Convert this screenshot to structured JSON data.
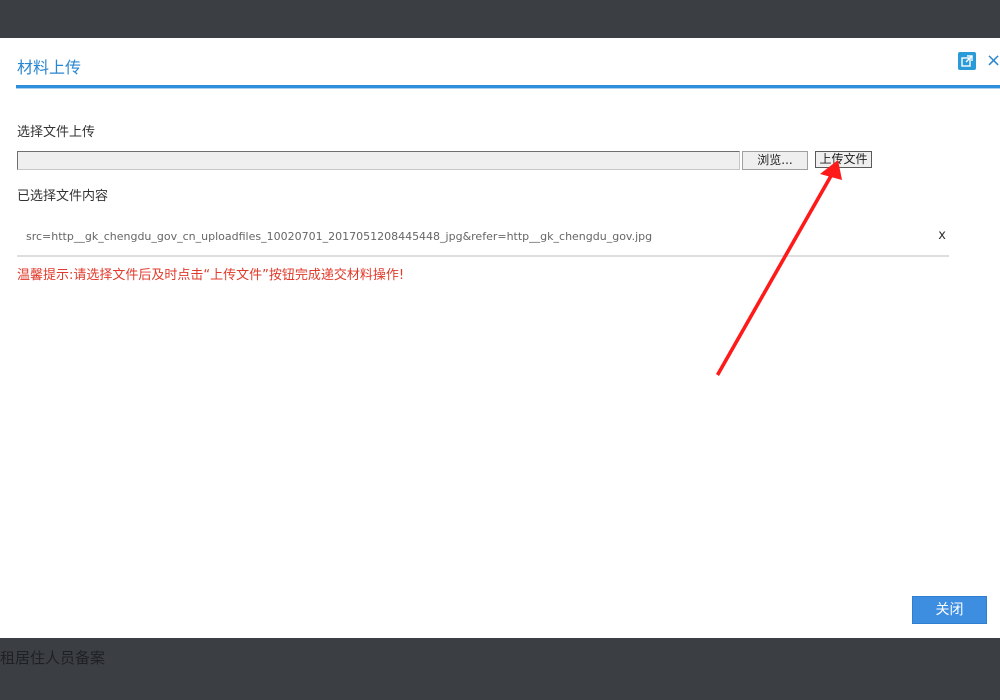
{
  "background": {
    "top_text": "",
    "bottom_text": "租居住人员备案"
  },
  "modal": {
    "title": "材料上传",
    "section_select_label": "选择文件上传",
    "browse_label": "浏览...",
    "upload_label": "上传文件",
    "section_selected_label": "已选择文件内容",
    "selected_files": [
      {
        "name": "src=http__gk_chengdu_gov_cn_uploadfiles_10020701_2017051208445448_jpg&refer=http__gk_chengdu_gov.jpg",
        "remove_label": "x"
      }
    ],
    "tip": "温馨提示:请选择文件后及时点击“上传文件”按钮完成递交材料操作!",
    "close_label": "关闭",
    "close_symbol": "×"
  },
  "colors": {
    "accent": "#2d8fdb",
    "tip": "#e03a2b",
    "primary_button": "#3d8ee0",
    "annotation_arrow": "#ff1a1a"
  },
  "icons": {
    "popout": "popout-icon",
    "close": "close-icon"
  }
}
